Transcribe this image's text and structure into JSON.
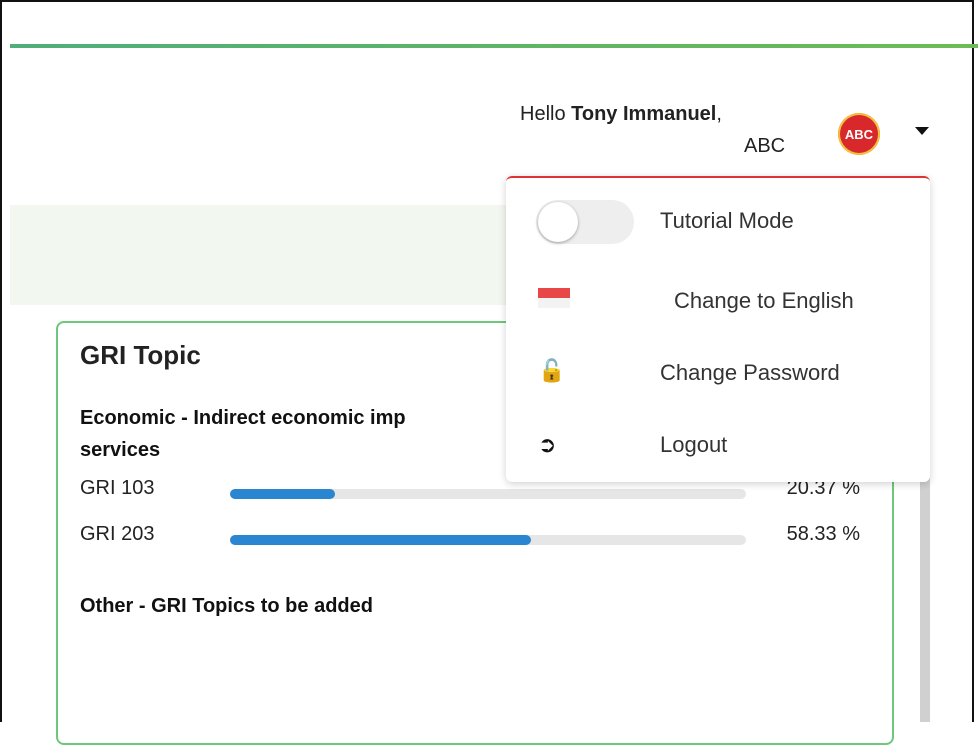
{
  "header": {
    "greeting_prefix": "Hello",
    "user_name": "Tony Immanuel",
    "greeting_suffix": ",",
    "organization": "ABC",
    "avatar_text": "ABC"
  },
  "dropdown": {
    "tutorial_mode_label": "Tutorial Mode",
    "tutorial_mode_on": false,
    "change_language_label": "Change to English",
    "change_password_label": "Change Password",
    "logout_label": "Logout",
    "icons": {
      "flag": "indonesia-flag-icon",
      "password": "lock-icon",
      "logout": "logout-icon"
    }
  },
  "card": {
    "title": "GRI Topic",
    "section_economic_line1": "Economic - Indirect economic imp",
    "section_economic_line2": "services",
    "gri_rows": [
      {
        "label": "GRI 103",
        "percent_text": "20.37 %",
        "percent": 20.37
      },
      {
        "label": "GRI 203",
        "percent_text": "58.33 %",
        "percent": 58.33
      }
    ],
    "section_other": "Other - GRI Topics to be added"
  },
  "colors": {
    "accent_green": "#6ec77a",
    "progress_blue": "#2a86d1",
    "avatar_red": "#d8282b",
    "dropdown_border": "#d33333"
  }
}
